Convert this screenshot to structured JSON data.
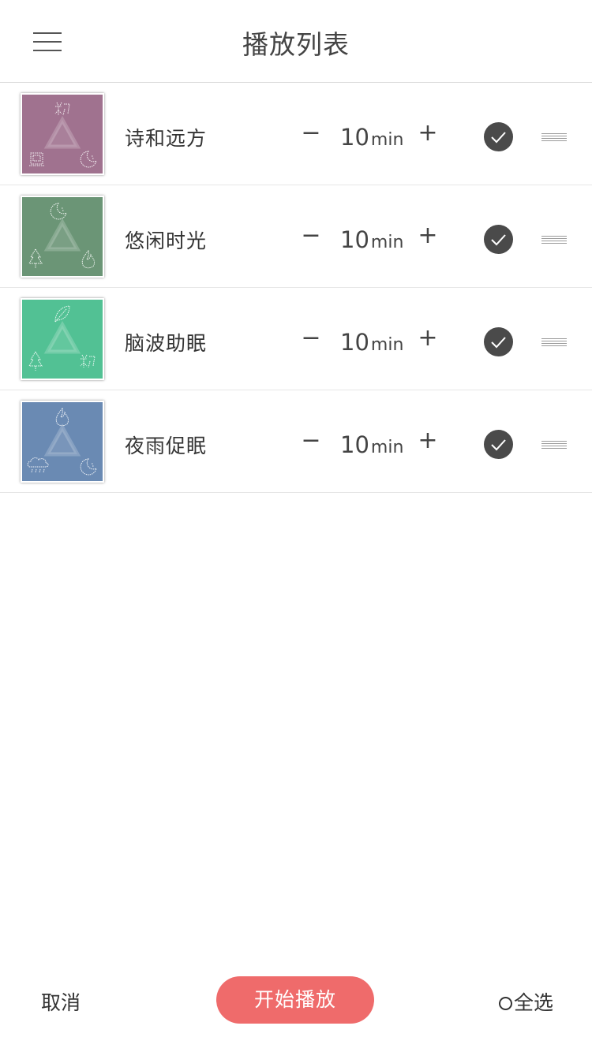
{
  "header": {
    "title": "播放列表",
    "menu_icon": "hamburger-menu-icon"
  },
  "playlist": [
    {
      "name": "诗和远方",
      "thumb_color": "#a0728f",
      "icons": [
        "seedling-icon",
        "radio-icon",
        "moon-icon"
      ],
      "duration": "10",
      "unit": "min",
      "minus": "−",
      "plus": "+",
      "checked": true
    },
    {
      "name": "悠闲时光",
      "thumb_color": "#6b9576",
      "icons": [
        "moon-icon",
        "tree-icon",
        "flame-icon"
      ],
      "duration": "10",
      "unit": "min",
      "minus": "−",
      "plus": "+",
      "checked": true
    },
    {
      "name": "脑波助眠",
      "thumb_color": "#52c194",
      "icons": [
        "leaf-icon",
        "tree-icon",
        "seedling-icon"
      ],
      "duration": "10",
      "unit": "min",
      "minus": "−",
      "plus": "+",
      "checked": true
    },
    {
      "name": "夜雨促眠",
      "thumb_color": "#6a8ab3",
      "icons": [
        "flame-icon",
        "rain-cloud-icon",
        "moon-icon"
      ],
      "duration": "10",
      "unit": "min",
      "minus": "−",
      "plus": "+",
      "checked": true
    }
  ],
  "footer": {
    "cancel_label": "取消",
    "start_label": "开始播放",
    "select_all_label": "全选"
  },
  "colors": {
    "accent": "#ef6b6b",
    "check": "#4a4a4a"
  }
}
